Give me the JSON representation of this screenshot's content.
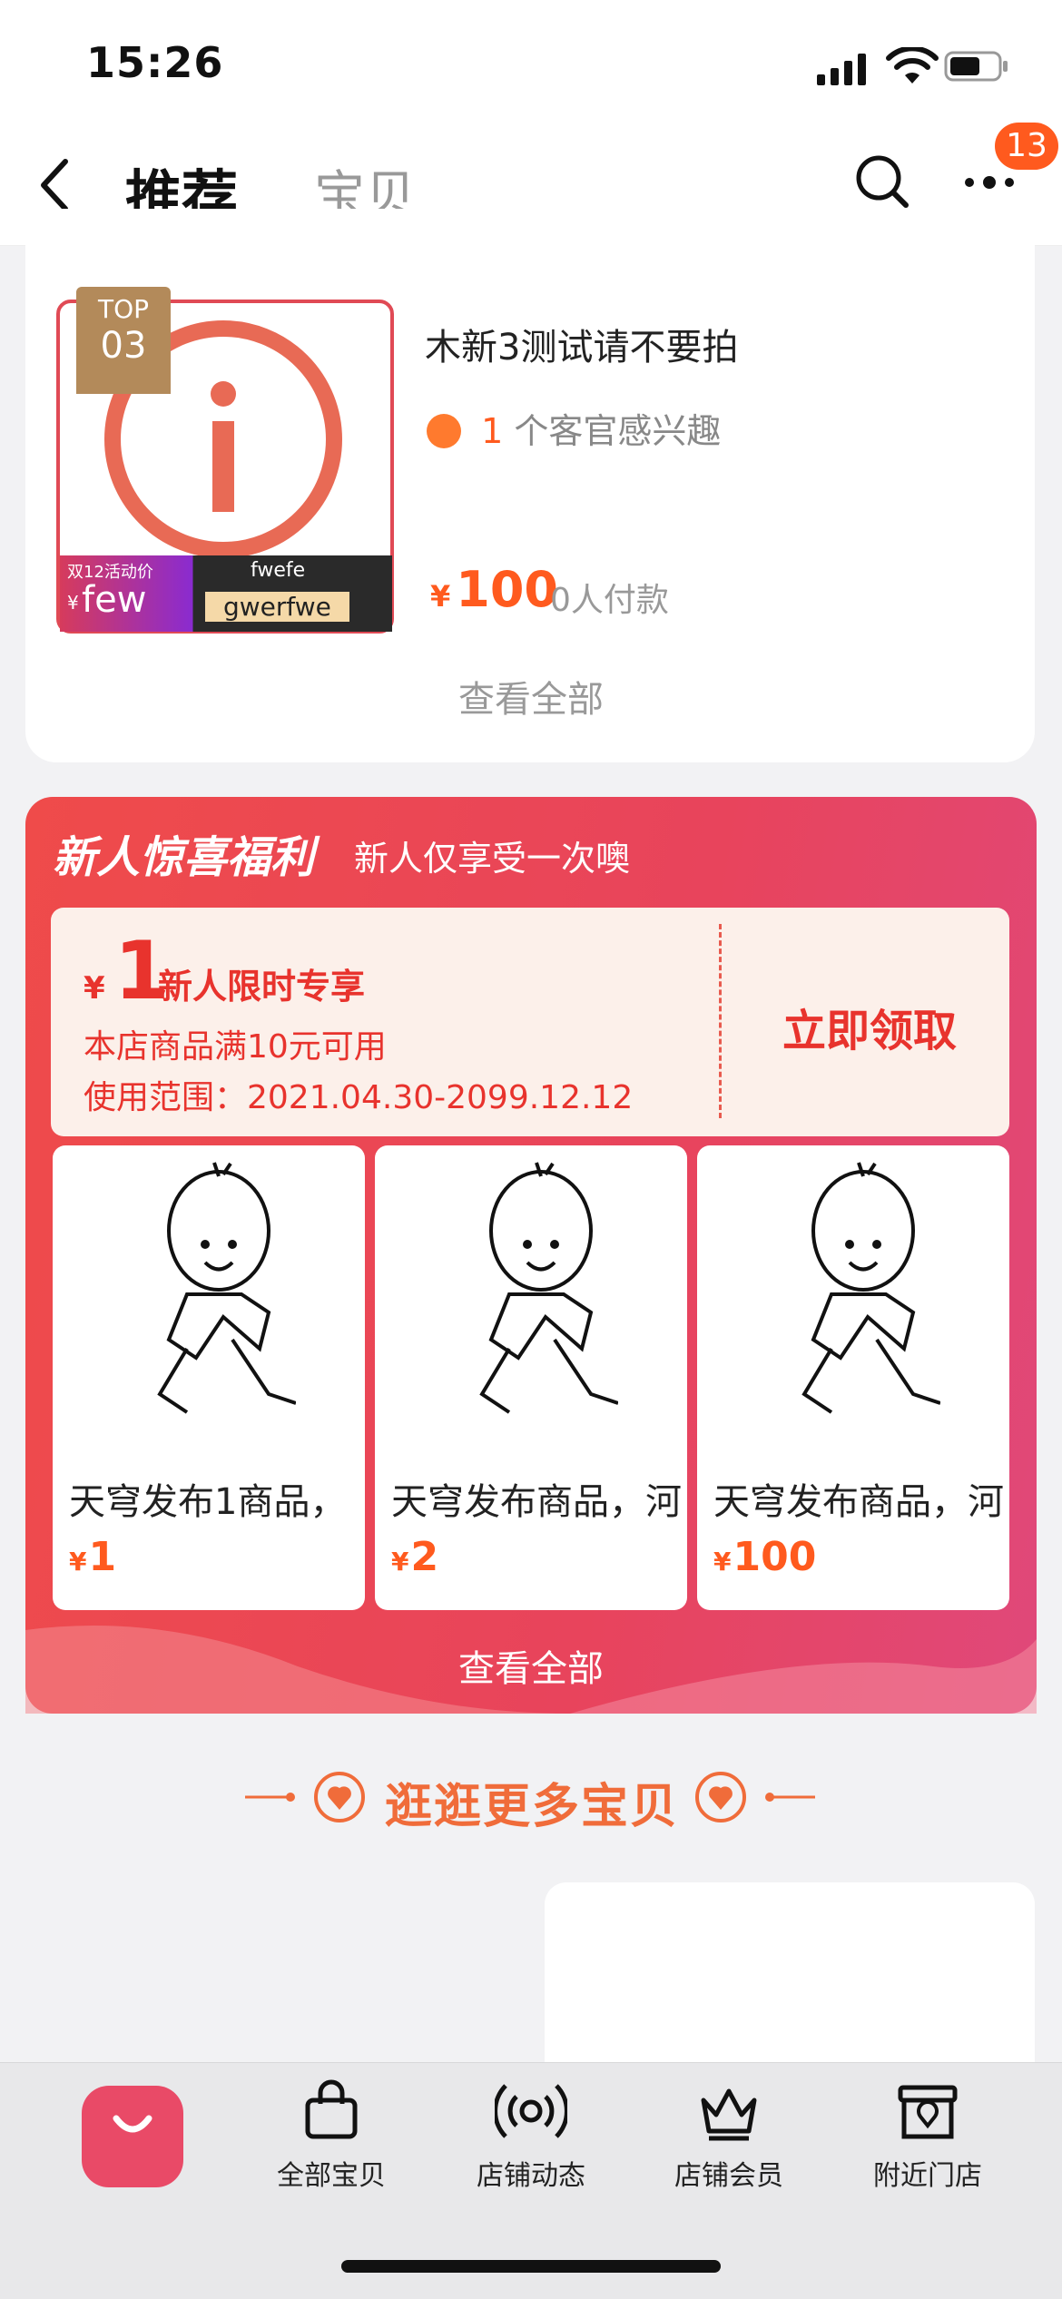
{
  "status_bar": {
    "time": "15:26"
  },
  "nav": {
    "title": "推荐",
    "tab2": "宝贝",
    "notification_count": "13"
  },
  "featured_product": {
    "rank_label": "TOP",
    "rank_number": "03",
    "thumb_top_text": "fwefe",
    "thumb_bottom_text": "gwerfwe",
    "thumb_promo_label": "双12活动价",
    "thumb_promo_price_currency": "¥",
    "thumb_promo_price": "few",
    "name": "木新3测试请不要拍",
    "interest_count": "1",
    "interest_text": "个客官感兴趣",
    "price_currency": "¥",
    "price": "100",
    "paid_text": "0人付款",
    "view_all": "查看全部"
  },
  "new_user": {
    "title": "新人惊喜福利",
    "subtitle": "新人仅享受一次噢",
    "coupon": {
      "currency": "¥",
      "amount": "1",
      "label": "新人限时专享",
      "condition": "本店商品满10元可用",
      "range": "使用范围：2021.04.30-2099.12.12",
      "claim": "立即领取"
    },
    "products": [
      {
        "title": "天穹发布1商品，",
        "currency": "¥",
        "price": "1"
      },
      {
        "title": "天穹发布商品，河",
        "currency": "¥",
        "price": "2"
      },
      {
        "title": "天穹发布商品，河",
        "currency": "¥",
        "price": "100"
      }
    ],
    "view_all": "查看全部"
  },
  "more_section": {
    "title": "逛逛更多宝贝"
  },
  "tabbar": {
    "items": [
      {
        "label": "全部宝贝",
        "icon": "bag-icon"
      },
      {
        "label": "店铺动态",
        "icon": "broadcast-icon"
      },
      {
        "label": "店铺会员",
        "icon": "crown-icon"
      },
      {
        "label": "附近门店",
        "icon": "store-icon"
      }
    ]
  },
  "colors": {
    "accent": "#ff5a1e",
    "promo_red": "#e8332d",
    "promo_bg": "#ef4b4a"
  }
}
